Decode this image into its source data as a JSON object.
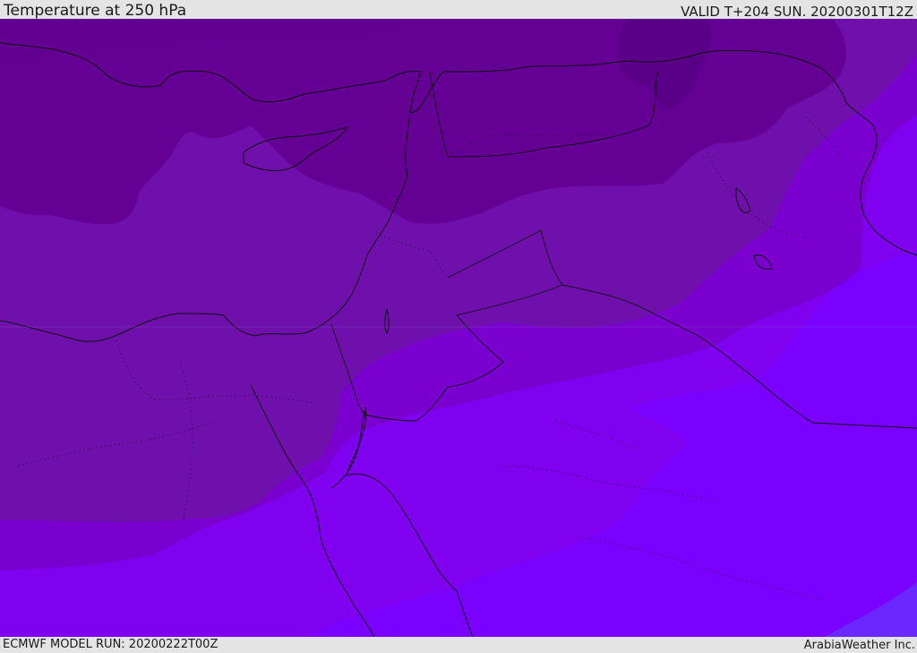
{
  "header": {
    "title": "Temperature at 250 hPa",
    "valid_time": "VALID T+204 SUN. 20200301T12Z"
  },
  "footer": {
    "model_run": "ECMWF MODEL RUN: 20200222T00Z",
    "credit": "ArabiaWeather Inc."
  },
  "map": {
    "colors": {
      "band_darkest": "#5a0088",
      "band_dark": "#640094",
      "band_mid": "#7010ac",
      "band_violet": "#7a00d0",
      "band_bright": "#8000f0",
      "band_brightest": "#7a00ff",
      "corner_blue": "#6a28ff",
      "coastline": "#111111"
    }
  }
}
